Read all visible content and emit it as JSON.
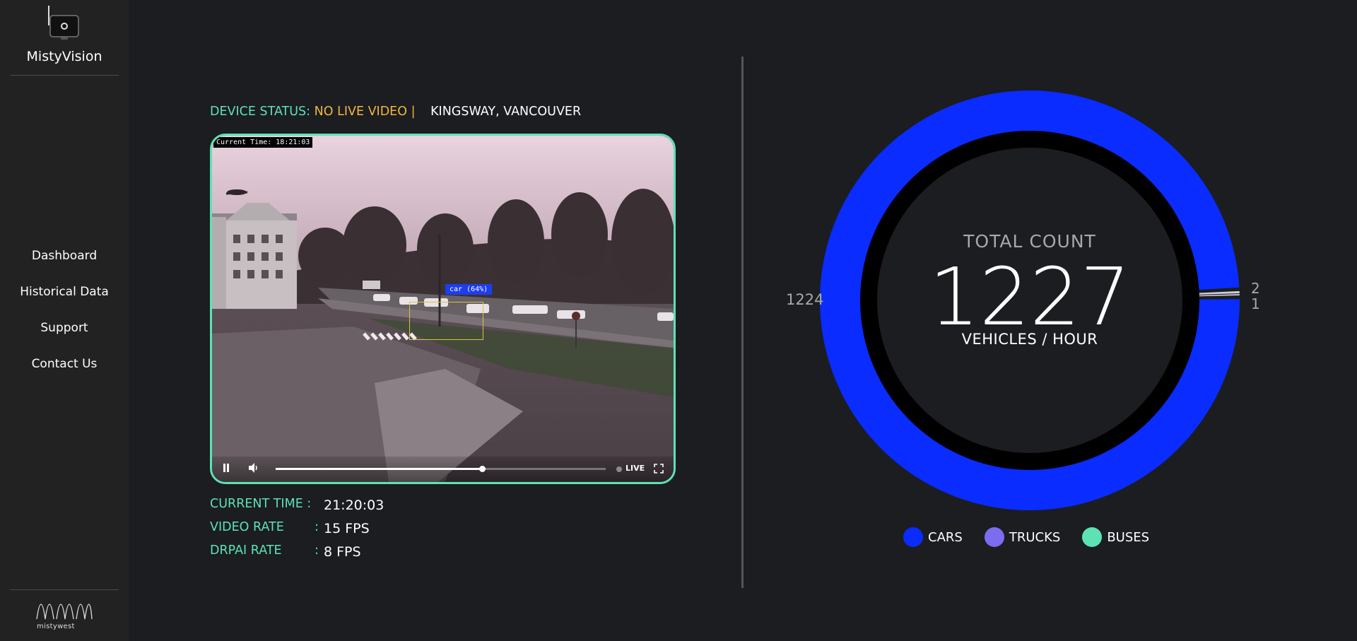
{
  "app": {
    "name": "MistyVision"
  },
  "sidebar": {
    "items": [
      {
        "label": "Dashboard"
      },
      {
        "label": "Historical Data"
      },
      {
        "label": "Support"
      },
      {
        "label": "Contact Us"
      }
    ],
    "footer_logo_text": "mistywest"
  },
  "device": {
    "status_label": "DEVICE STATUS:",
    "status_value": "NO LIVE VIDEO |",
    "location": "KINGSWAY, VANCOUVER"
  },
  "video": {
    "timestamp_overlay": "Current Time: 18:21:03",
    "detection_label": "car (64%)",
    "progress": 0.625,
    "live_label": "LIVE"
  },
  "stats": [
    {
      "label": "CURRENT TIME :",
      "colon": "",
      "value": "21:20:03"
    },
    {
      "label": "VIDEO RATE",
      "colon": ":",
      "value": "15 FPS"
    },
    {
      "label": "DRPAI RATE",
      "colon": ":",
      "value": "8 FPS"
    }
  ],
  "chart_data": {
    "type": "pie",
    "title": "TOTAL COUNT",
    "total": "1227",
    "unit": "VEHICLES / HOUR",
    "series": [
      {
        "name": "CARS",
        "value": 1224,
        "color": "#0a2cff"
      },
      {
        "name": "TRUCKS",
        "value": 2,
        "color": "#7b6cf0"
      },
      {
        "name": "BUSES",
        "value": 1,
        "color": "#5ee2b5"
      }
    ],
    "labels": {
      "left": "1224",
      "right_top": "2",
      "right_bottom": "1"
    },
    "legend_position": "bottom"
  },
  "colors": {
    "accent": "#5ee2b5",
    "warning": "#f3b63d",
    "cars": "#0a2cff",
    "trucks": "#7b6cf0",
    "buses": "#5ee2b5"
  }
}
